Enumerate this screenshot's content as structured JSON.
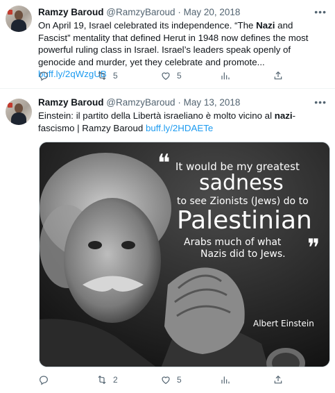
{
  "tweets": [
    {
      "author": "Ramzy Baroud",
      "handle": "@RamzyBaroud",
      "separator": "·",
      "date": "May 20, 2018",
      "text_parts": {
        "p1": "On April 19, Israel celebrated its independence. “The ",
        "bold1": "Nazi",
        "p2": " and Fascist” mentality that defined Herut in 1948 now defines the most powerful ruling class in Israel. Israel’s leaders speak openly of genocide and murder, yet they celebrate and promote... ",
        "link": "buff.ly/2qWzgUB"
      },
      "retweets": "5",
      "likes": "5"
    },
    {
      "author": "Ramzy Baroud",
      "handle": "@RamzyBaroud",
      "separator": "·",
      "date": "May 13, 2018",
      "text_parts": {
        "p1": "Einstein: il partito della Libertà israeliano è molto vicino al ",
        "bold1": "nazi",
        "p2": "-fascismo | Ramzy Baroud ",
        "link": "buff.ly/2HDAETe"
      },
      "image": {
        "quote_mark_open": "❝",
        "line1": "It would be my greatest",
        "line2": "sadness",
        "line3": "to see Zionists (Jews) do to",
        "line4": "Palestinian",
        "line5": "Arabs much of what",
        "line6": "Nazis did to Jews.",
        "quote_mark_close": "❞",
        "attribution": "Albert Einstein"
      },
      "retweets": "2",
      "likes": "5"
    }
  ],
  "icons": [
    "more-icon",
    "reply-icon",
    "retweet-icon",
    "like-icon",
    "views-icon",
    "share-icon"
  ],
  "colors": {
    "link": "#1d9bf0",
    "meta": "#536471",
    "text": "#0f1419"
  }
}
